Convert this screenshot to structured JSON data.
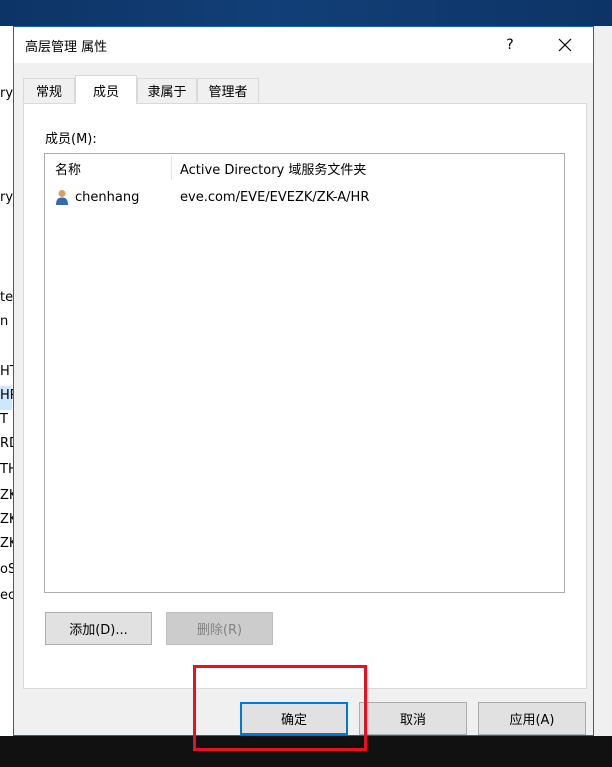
{
  "dialog": {
    "title": "高层管理 属性",
    "help_label": "?",
    "close_label": "✕"
  },
  "tabs": [
    {
      "label": "常规",
      "active": false
    },
    {
      "label": "成员",
      "active": true
    },
    {
      "label": "隶属于",
      "active": false
    },
    {
      "label": "管理者",
      "active": false
    }
  ],
  "members": {
    "label": "成员(M):",
    "columns": [
      "名称",
      "Active Directory 域服务文件夹"
    ],
    "rows": [
      {
        "name": "chenhang",
        "folder": "eve.com/EVE/EVEZK/ZK-A/HR",
        "icon": "user-icon"
      }
    ],
    "add_button": "添加(D)...",
    "remove_button": "删除(R)"
  },
  "footer": {
    "ok_button": "确定",
    "cancel_button": "取消",
    "apply_button": "应用(A)"
  },
  "background_window": {
    "text_fragments": [
      "ry",
      "ry",
      "te",
      "n C",
      "HT",
      "HR",
      "T",
      "RD",
      "TH",
      "ZK",
      "ZK",
      "ZK",
      "oSc",
      "ec"
    ]
  },
  "colors": {
    "accent": "#0078d7",
    "highlight_box": "#e81123",
    "dialog_border": "#1f62b0"
  }
}
